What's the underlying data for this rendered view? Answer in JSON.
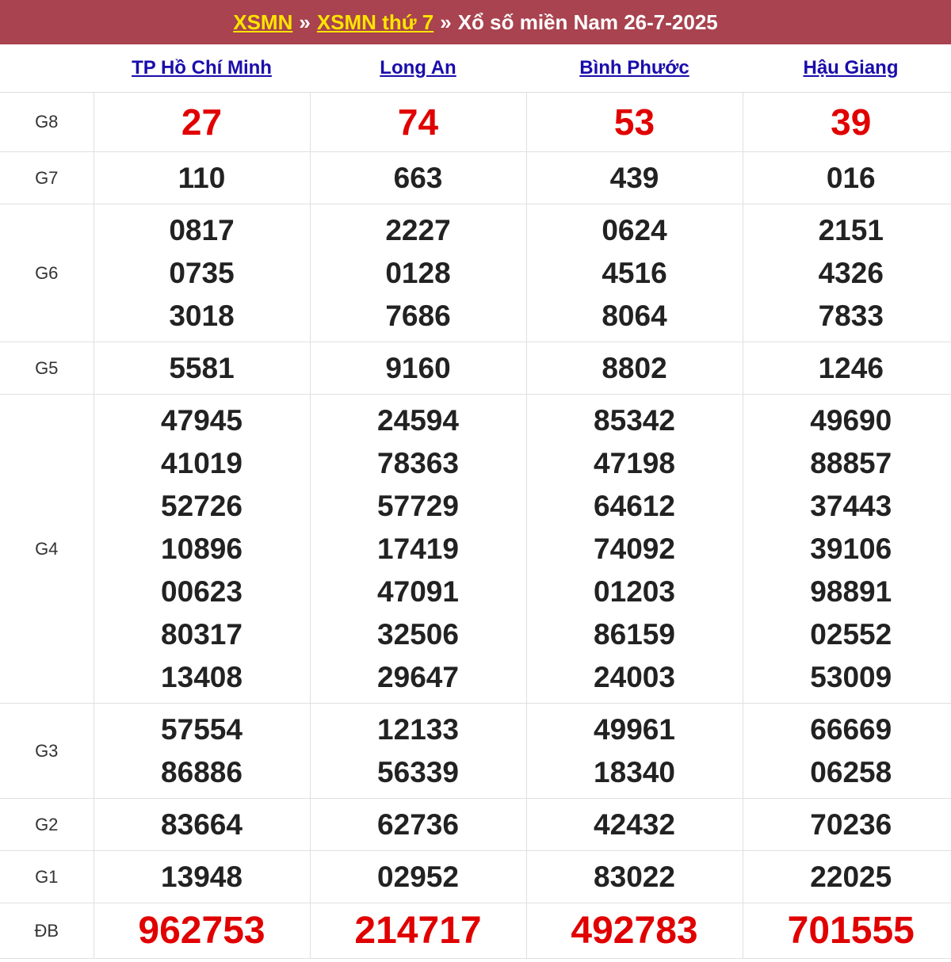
{
  "header": {
    "link1": "XSMN",
    "sep1": "»",
    "link2": "XSMN thứ 7",
    "sep2": "»",
    "title": "Xổ số miền Nam 26-7-2025"
  },
  "provinces": [
    "TP Hồ Chí Minh",
    "Long An",
    "Bình Phước",
    "Hậu Giang"
  ],
  "colors": {
    "header_bg": "#a8434f",
    "link_yellow": "#ffe400",
    "prize_red": "#e00000",
    "province_link": "#1a0dab"
  },
  "prizes": [
    {
      "label": "G8",
      "values": [
        [
          "27"
        ],
        [
          "74"
        ],
        [
          "53"
        ],
        [
          "39"
        ]
      ]
    },
    {
      "label": "G7",
      "values": [
        [
          "110"
        ],
        [
          "663"
        ],
        [
          "439"
        ],
        [
          "016"
        ]
      ]
    },
    {
      "label": "G6",
      "values": [
        [
          "0817",
          "0735",
          "3018"
        ],
        [
          "2227",
          "0128",
          "7686"
        ],
        [
          "0624",
          "4516",
          "8064"
        ],
        [
          "2151",
          "4326",
          "7833"
        ]
      ]
    },
    {
      "label": "G5",
      "values": [
        [
          "5581"
        ],
        [
          "9160"
        ],
        [
          "8802"
        ],
        [
          "1246"
        ]
      ]
    },
    {
      "label": "G4",
      "values": [
        [
          "47945",
          "41019",
          "52726",
          "10896",
          "00623",
          "80317",
          "13408"
        ],
        [
          "24594",
          "78363",
          "57729",
          "17419",
          "47091",
          "32506",
          "29647"
        ],
        [
          "85342",
          "47198",
          "64612",
          "74092",
          "01203",
          "86159",
          "24003"
        ],
        [
          "49690",
          "88857",
          "37443",
          "39106",
          "98891",
          "02552",
          "53009"
        ]
      ]
    },
    {
      "label": "G3",
      "values": [
        [
          "57554",
          "86886"
        ],
        [
          "12133",
          "56339"
        ],
        [
          "49961",
          "18340"
        ],
        [
          "66669",
          "06258"
        ]
      ]
    },
    {
      "label": "G2",
      "values": [
        [
          "83664"
        ],
        [
          "62736"
        ],
        [
          "42432"
        ],
        [
          "70236"
        ]
      ]
    },
    {
      "label": "G1",
      "values": [
        [
          "13948"
        ],
        [
          "02952"
        ],
        [
          "83022"
        ],
        [
          "22025"
        ]
      ]
    },
    {
      "label": "ĐB",
      "values": [
        [
          "962753"
        ],
        [
          "214717"
        ],
        [
          "492783"
        ],
        [
          "701555"
        ]
      ]
    }
  ]
}
